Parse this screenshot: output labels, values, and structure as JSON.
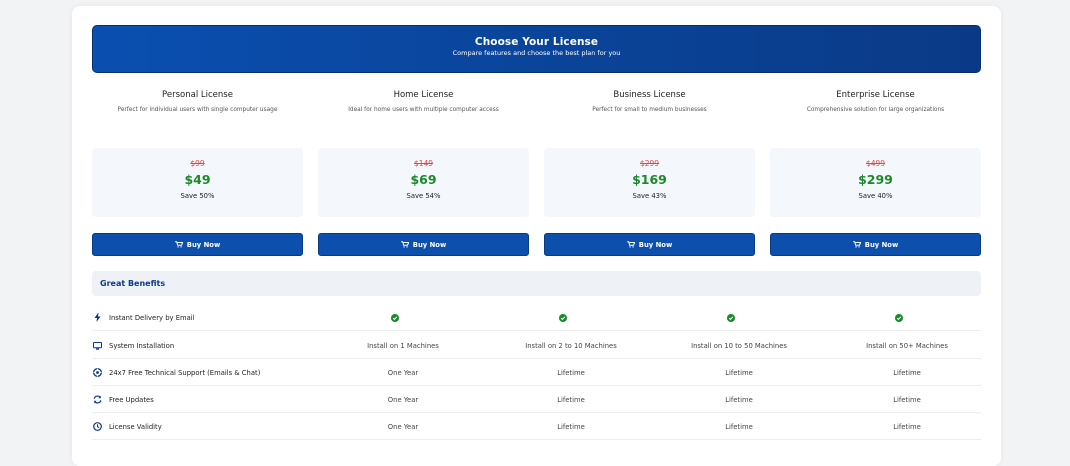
{
  "header": {
    "title": "Choose Your License",
    "subtitle": "Compare features and choose the best plan for you"
  },
  "plans": [
    {
      "name": "Personal License",
      "description": "Perfect for individual users with single computer usage",
      "old_price": "$99",
      "price": "$49",
      "save": "Save 50%",
      "button": "Buy Now"
    },
    {
      "name": "Home License",
      "description": "Ideal for home users with multiple computer access",
      "old_price": "$149",
      "price": "$69",
      "save": "Save 54%",
      "button": "Buy Now"
    },
    {
      "name": "Business License",
      "description": "Perfect for small to medium businesses",
      "old_price": "$299",
      "price": "$169",
      "save": "Save 43%",
      "button": "Buy Now"
    },
    {
      "name": "Enterprise License",
      "description": "Comprehensive solution for large organizations",
      "old_price": "$499",
      "price": "$299",
      "save": "Save 40%",
      "button": "Buy Now"
    }
  ],
  "benefits": {
    "title": "Great Benefits",
    "rows": [
      {
        "icon": "lightning-icon",
        "feature": "Instant Delivery by Email",
        "values": [
          "check",
          "check",
          "check",
          "check"
        ]
      },
      {
        "icon": "monitor-icon",
        "feature": "System Installation",
        "values": [
          "Install on 1 Machines",
          "Install on 2 to 10 Machines",
          "Install on 10 to 50 Machines",
          "Install on 50+ Machines"
        ]
      },
      {
        "icon": "support-icon",
        "feature": "24x7 Free Technical Support (Emails & Chat)",
        "values": [
          "One Year",
          "Lifetime",
          "Lifetime",
          "Lifetime"
        ]
      },
      {
        "icon": "sync-icon",
        "feature": "Free Updates",
        "values": [
          "One Year",
          "Lifetime",
          "Lifetime",
          "Lifetime"
        ]
      },
      {
        "icon": "clock-icon",
        "feature": "License Validity",
        "values": [
          "One Year",
          "Lifetime",
          "Lifetime",
          "Lifetime"
        ]
      }
    ]
  },
  "colors": {
    "accent": "#0c4fad",
    "price_green": "#1a8a2a",
    "old_price_red": "#d94a4a",
    "check_green": "#1a8a2a"
  }
}
